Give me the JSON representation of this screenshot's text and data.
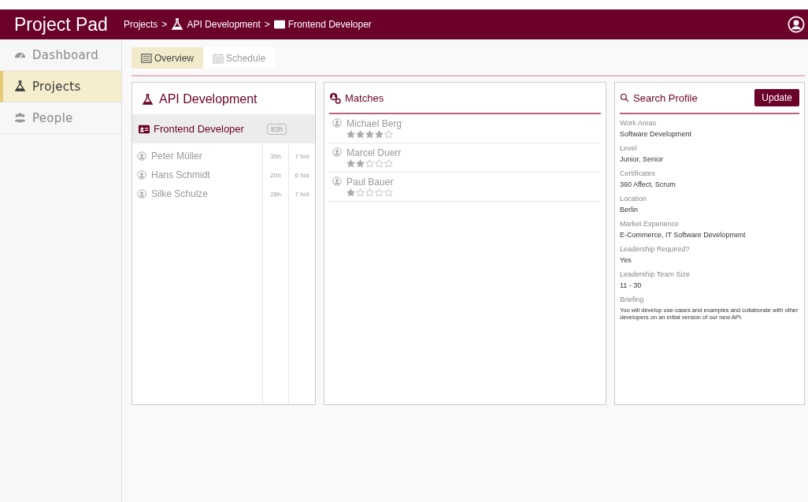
{
  "header": {
    "app_title": "Project Pad",
    "breadcrumb": [
      {
        "label": "Projects",
        "kind": "plain"
      },
      {
        "label": "API Development",
        "kind": "project"
      },
      {
        "label": "Frontend Developer",
        "kind": "role"
      }
    ],
    "separator": ">"
  },
  "sidebar": {
    "items": [
      {
        "label": "Dashboard",
        "selected": false
      },
      {
        "label": "Projects",
        "selected": true
      },
      {
        "label": "People",
        "selected": false
      }
    ]
  },
  "tabs": [
    {
      "label": "Overview",
      "selected": true
    },
    {
      "label": "Schedule",
      "selected": false
    }
  ],
  "project": {
    "title": "API Development",
    "role": {
      "label": "Frontend Developer",
      "hours": "83h",
      "selected": true
    },
    "members": [
      {
        "name": "Peter Müller",
        "hours": "35h",
        "rate": "7 h/d"
      },
      {
        "name": "Hans Schmidt",
        "hours": "20h",
        "rate": "6 h/d"
      },
      {
        "name": "Silke Schulze",
        "hours": "28h",
        "rate": "7 h/d"
      }
    ]
  },
  "matches": {
    "title": "Matches",
    "items": [
      {
        "name": "Michael Berg",
        "stars": 4
      },
      {
        "name": "Marcel Duerr",
        "stars": 2
      },
      {
        "name": "Paul Bauer",
        "stars": 1
      }
    ]
  },
  "search_profile": {
    "title": "Search Profile",
    "button": "Update",
    "fields": [
      {
        "label": "Work Areas",
        "value": "Software Development"
      },
      {
        "label": "Level",
        "value": "Junior, Senior"
      },
      {
        "label": "Certificates",
        "value": "360 Affect, Scrum"
      },
      {
        "label": "Location",
        "value": "Berlin"
      },
      {
        "label": "Market Experience",
        "value": "E-Commerce, IT Software Development"
      },
      {
        "label": "Leadership Required?",
        "value": "Yes"
      },
      {
        "label": "Leadership Team Size",
        "value": "11 - 30"
      },
      {
        "label": "Briefing",
        "value": "You will develop use-cases and examples and collaborate with other developers on an initial version of our new API."
      }
    ]
  }
}
